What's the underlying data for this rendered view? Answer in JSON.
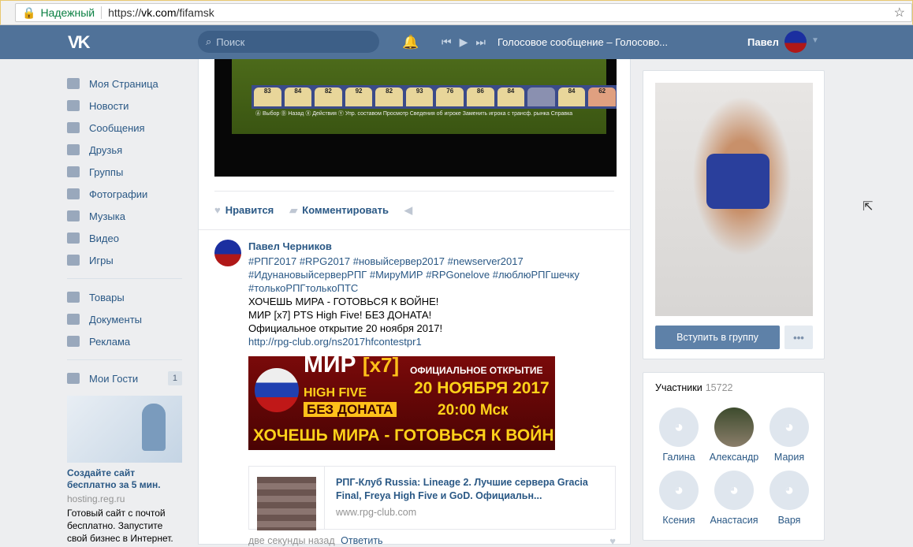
{
  "browser": {
    "secure_label": "Надежный",
    "url_scheme": "https://",
    "url_host": "vk.com",
    "url_path": "/fifamsk"
  },
  "header": {
    "logo": "VK",
    "search_placeholder": "Поиск",
    "track": "Голосовое сообщение – Голосово...",
    "user_name": "Павел"
  },
  "sidebar": {
    "items": [
      {
        "label": "Моя Страница"
      },
      {
        "label": "Новости"
      },
      {
        "label": "Сообщения"
      },
      {
        "label": "Друзья"
      },
      {
        "label": "Группы"
      },
      {
        "label": "Фотографии"
      },
      {
        "label": "Музыка"
      },
      {
        "label": "Видео"
      },
      {
        "label": "Игры"
      }
    ],
    "items2": [
      {
        "label": "Товары"
      },
      {
        "label": "Документы"
      },
      {
        "label": "Реклама"
      }
    ],
    "guests": {
      "label": "Мои Гости",
      "count": "1"
    },
    "ad": {
      "title": "Создайте сайт бесплатно за 5 мин.",
      "url": "hosting.reg.ru",
      "desc": "Готовый сайт с почтой бесплатно. Запустите свой бизнес в Интернет."
    }
  },
  "photo": {
    "ratings": [
      "83",
      "84",
      "82",
      "92",
      "82",
      "93",
      "76",
      "86",
      "84",
      "",
      "84",
      "62"
    ],
    "controls": "Ⓐ Выбор  Ⓑ Назад  Ⓧ Действия  Ⓨ Упр. составом  Просмотр  Сведения об игроке  Заменить игрока с трансф. рынка  Справка"
  },
  "actions": {
    "like": "Нравится",
    "comment": "Комментировать"
  },
  "post": {
    "author": "Павел Черников",
    "tags": "#РПГ2017 #RPG2017 #новыйсервер2017 #newserver2017 #ИдунановыйсерверРПГ #МируМИР #RPGonelove #люблюРПГшечку #толькоРПГтолькоПТС",
    "line1": "ХОЧЕШЬ МИРА - ГОТОВЬСЯ К ВОЙНЕ!",
    "line2": "МИР [x7] PTS High Five! БЕЗ ДОНАТА!",
    "line3": "Официальное открытие 20 ноября 2017!",
    "link": "http://rpg-club.org/ns2017hfcontestpr1",
    "banner": {
      "mir": "МИР",
      "x7": "[x7]",
      "hf": "HIGH FIVE",
      "donat": "БЕЗ ДОНАТА",
      "open": "ОФИЦИАЛЬНОЕ ОТКРЫТИЕ",
      "date": "20 НОЯБРЯ 2017",
      "time": "20:00 Мск",
      "slogan": "ХОЧЕШЬ МИРА - ГОТОВЬСЯ К ВОЙНЕ"
    },
    "snippet": {
      "title": "РПГ-Клуб Russia: Lineage 2. Лучшие сервера Gracia Final, Freya High Five и GoD. Официальн...",
      "url": "www.rpg-club.com"
    },
    "time": "две секунды назад",
    "reply": "Ответить"
  },
  "group": {
    "join": "Вступить в группу",
    "more": "•••"
  },
  "members": {
    "label": "Участники",
    "count": "15722",
    "list": [
      {
        "name": "Галина"
      },
      {
        "name": "Александр"
      },
      {
        "name": "Мария"
      },
      {
        "name": "Ксения"
      },
      {
        "name": "Анастасия"
      },
      {
        "name": "Варя"
      }
    ]
  }
}
